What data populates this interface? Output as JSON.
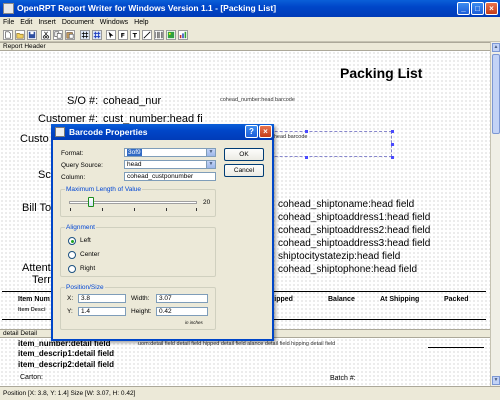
{
  "window": {
    "title": "OpenRPT Report Writer for Windows Version 1.1 - [Packing List]"
  },
  "menubar": [
    "File",
    "Edit",
    "Insert",
    "Document",
    "Windows",
    "Help"
  ],
  "toolbar": {
    "icons": [
      "new-icon",
      "open-icon",
      "save-icon",
      "cut-icon",
      "copy-icon",
      "paste-icon",
      "grid-icon",
      "snap-grid-icon",
      "select-icon",
      "field-icon",
      "label-icon",
      "line-icon",
      "barcode-icon",
      "image-icon",
      "graph-icon"
    ]
  },
  "report": {
    "sections": {
      "report_header": "Report Header",
      "detail": "detail Detail"
    },
    "title": "Packing List",
    "so_label": "S/O #:",
    "so_field": "cohead_nur",
    "barcode_field1": "cohead_number:head barcode",
    "customer_label": "Customer #:",
    "customer_field": "cust_number:head fi",
    "custo_partial": "Custo",
    "barcode_field2": "rhead barcode",
    "sc_partial": "Sc",
    "bill_to_partial": "Bill To",
    "ship_fields": [
      "cohead_shiptoname:head field",
      "cohead_shiptoaddress1:head field",
      "cohead_shiptoaddress2:head field",
      "cohead_shiptoaddress3:head field",
      "shiptocitystatezip:head field",
      "cohead_shiptophone:head field"
    ],
    "attention_partial": "Attenti",
    "terms_partial": "Terr",
    "col_headers": {
      "item_number": "Item Num",
      "item_desc": "Item Desci",
      "shipped": "hipped",
      "balance": "Balance",
      "at_shipping": "At Shipping",
      "packed": "Packed"
    },
    "detail_fields": {
      "item_number": "item_number:detail field",
      "row1_rest": "uom:detail field detail field hipped detail field alance detail field hipping detail field",
      "item_descrip1": "item_descrip1:detail field",
      "item_descrip2": "item_descrip2:detail field",
      "carton": "Carton:",
      "batch": "Batch #:"
    }
  },
  "dialog": {
    "title": "Barcode Properties",
    "format_label": "Format:",
    "format_value": "3of9",
    "query_label": "Query Source:",
    "query_value": "head",
    "column_label": "Column:",
    "column_value": "cohead_custponumber",
    "max_length_title": "Maximum Length of Value",
    "max_length_value": "20",
    "max_length_fraction": 0.17,
    "alignment_title": "Alignment",
    "alignment_options": [
      "Left",
      "Center",
      "Right"
    ],
    "alignment_selected": "Left",
    "position_title": "Position/Size",
    "x_label": "X:",
    "x_value": "3.8",
    "y_label": "Y:",
    "y_value": "1.4",
    "width_label": "Width:",
    "width_value": "3.07",
    "height_label": "Height:",
    "height_value": "0.42",
    "units_note": "in inches",
    "ok_label": "OK",
    "cancel_label": "Cancel"
  },
  "statusbar": {
    "text": "Position [X: 3.8, Y: 1.4]     Size [W: 3.07, H: 0.42]"
  }
}
